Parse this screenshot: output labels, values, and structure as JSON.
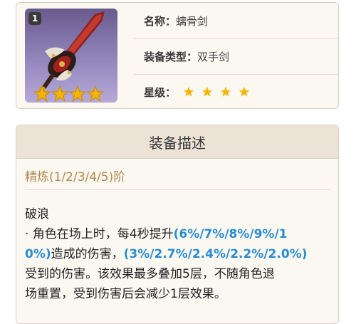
{
  "item": {
    "rarity_badge": "1",
    "star_count": 4,
    "colors": {
      "star": "#f4b400",
      "highlight": "#2a8cd0",
      "refine": "#b08a4e"
    },
    "rows": [
      {
        "label": "名称：",
        "value": "螭骨剑"
      },
      {
        "label": "装备类型：",
        "value": "双手剑"
      },
      {
        "label": "星级：",
        "value": ""
      }
    ]
  },
  "description": {
    "header": "装备描述",
    "refine_label": "精炼(1/2/3/4/5)阶",
    "skill_name": "破浪",
    "line1_prefix": "· 角色在场上时，每4秒提升",
    "line1_hl": "(6%/7%/8%/9%/1",
    "line2_hl": "0%)",
    "line2_mid": "造成的伤害，",
    "line2_hl2": "(3%/2.7%/2.4%/2.2%/2.0%)",
    "line3": "受到的伤害。该效果最多叠加5层，不随角色退",
    "line4": "场重置，受到伤害后会减少1层效果。"
  }
}
